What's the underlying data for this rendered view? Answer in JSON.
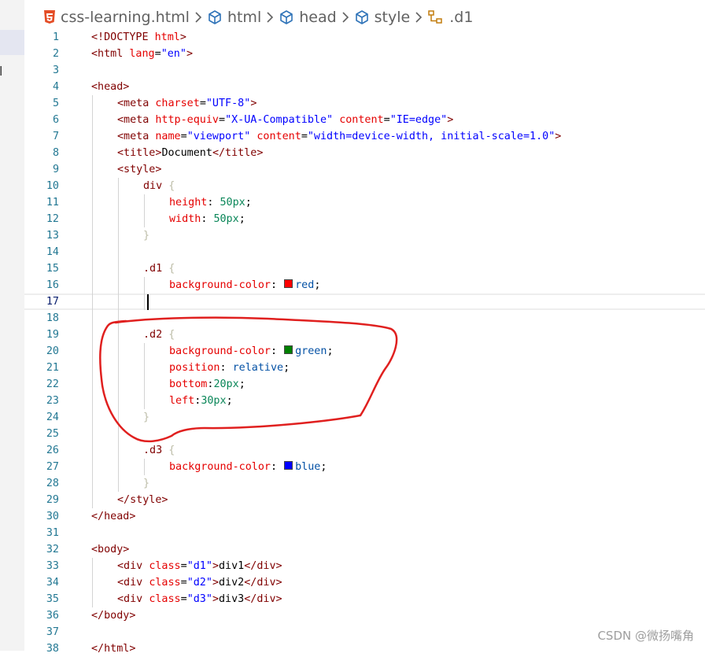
{
  "sidebar": {
    "partial_label": "l"
  },
  "breadcrumb": {
    "items": [
      {
        "label": "css-learning.html",
        "icon": "html5-icon"
      },
      {
        "label": "html",
        "icon": "cube-icon"
      },
      {
        "label": "head",
        "icon": "cube-icon"
      },
      {
        "label": "style",
        "icon": "cube-icon"
      },
      {
        "label": ".d1",
        "icon": "selector-icon"
      }
    ],
    "separator_icon": "chevron-right-icon"
  },
  "editor": {
    "current_line": 17,
    "lines": [
      {
        "n": "1",
        "indent": 0,
        "tokens": [
          [
            "tag",
            "<!DOCTYPE "
          ],
          [
            "attr",
            "html"
          ],
          [
            "tag",
            ">"
          ]
        ]
      },
      {
        "n": "2",
        "indent": 0,
        "tokens": [
          [
            "tag",
            "<html "
          ],
          [
            "attr",
            "lang"
          ],
          [
            "punc",
            "="
          ],
          [
            "str",
            "\"en\""
          ],
          [
            "tag",
            ">"
          ]
        ]
      },
      {
        "n": "3",
        "indent": 0,
        "tokens": []
      },
      {
        "n": "4",
        "indent": 0,
        "tokens": [
          [
            "tag",
            "<head>"
          ]
        ]
      },
      {
        "n": "5",
        "indent": 1,
        "tokens": [
          [
            "tag",
            "<meta "
          ],
          [
            "attr",
            "charset"
          ],
          [
            "punc",
            "="
          ],
          [
            "str",
            "\"UTF-8\""
          ],
          [
            "tag",
            ">"
          ]
        ]
      },
      {
        "n": "6",
        "indent": 1,
        "tokens": [
          [
            "tag",
            "<meta "
          ],
          [
            "attr",
            "http-equiv"
          ],
          [
            "punc",
            "="
          ],
          [
            "str",
            "\"X-UA-Compatible\""
          ],
          [
            "punc",
            " "
          ],
          [
            "attr",
            "content"
          ],
          [
            "punc",
            "="
          ],
          [
            "str",
            "\"IE=edge\""
          ],
          [
            "tag",
            ">"
          ]
        ]
      },
      {
        "n": "7",
        "indent": 1,
        "tokens": [
          [
            "tag",
            "<meta "
          ],
          [
            "attr",
            "name"
          ],
          [
            "punc",
            "="
          ],
          [
            "str",
            "\"viewport\""
          ],
          [
            "punc",
            " "
          ],
          [
            "attr",
            "content"
          ],
          [
            "punc",
            "="
          ],
          [
            "str",
            "\"width=device-width, initial-scale=1.0\""
          ],
          [
            "tag",
            ">"
          ]
        ]
      },
      {
        "n": "8",
        "indent": 1,
        "tokens": [
          [
            "tag",
            "<title>"
          ],
          [
            "text",
            "Document"
          ],
          [
            "tag",
            "</title>"
          ]
        ]
      },
      {
        "n": "9",
        "indent": 1,
        "tokens": [
          [
            "tag",
            "<style>"
          ]
        ]
      },
      {
        "n": "10",
        "indent": 2,
        "tokens": [
          [
            "sel",
            "div "
          ],
          [
            "brace",
            "{"
          ]
        ]
      },
      {
        "n": "11",
        "indent": 3,
        "tokens": [
          [
            "prop",
            "height"
          ],
          [
            "punc",
            ": "
          ],
          [
            "num",
            "50px"
          ],
          [
            "punc",
            ";"
          ]
        ]
      },
      {
        "n": "12",
        "indent": 3,
        "tokens": [
          [
            "prop",
            "width"
          ],
          [
            "punc",
            ": "
          ],
          [
            "num",
            "50px"
          ],
          [
            "punc",
            ";"
          ]
        ]
      },
      {
        "n": "13",
        "indent": 2,
        "tokens": [
          [
            "brace",
            "}"
          ]
        ]
      },
      {
        "n": "14",
        "indent": 0,
        "tokens": []
      },
      {
        "n": "15",
        "indent": 2,
        "tokens": [
          [
            "sel",
            ".d1 "
          ],
          [
            "brace",
            "{"
          ]
        ]
      },
      {
        "n": "16",
        "indent": 3,
        "tokens": [
          [
            "prop",
            "background-color"
          ],
          [
            "punc",
            ": "
          ],
          [
            "swatch",
            "#ff0000"
          ],
          [
            "kw",
            "red"
          ],
          [
            "punc",
            ";"
          ]
        ]
      },
      {
        "n": "17",
        "indent": 0,
        "tokens": []
      },
      {
        "n": "18",
        "indent": 0,
        "tokens": []
      },
      {
        "n": "19",
        "indent": 2,
        "tokens": [
          [
            "sel",
            ".d2 "
          ],
          [
            "brace",
            "{"
          ]
        ]
      },
      {
        "n": "20",
        "indent": 3,
        "tokens": [
          [
            "prop",
            "background-color"
          ],
          [
            "punc",
            ": "
          ],
          [
            "swatch",
            "#008000"
          ],
          [
            "kw",
            "green"
          ],
          [
            "punc",
            ";"
          ]
        ]
      },
      {
        "n": "21",
        "indent": 3,
        "tokens": [
          [
            "prop",
            "position"
          ],
          [
            "punc",
            ": "
          ],
          [
            "kw",
            "relative"
          ],
          [
            "punc",
            ";"
          ]
        ]
      },
      {
        "n": "22",
        "indent": 3,
        "tokens": [
          [
            "prop",
            "bottom"
          ],
          [
            "punc",
            ":"
          ],
          [
            "num",
            "20px"
          ],
          [
            "punc",
            ";"
          ]
        ]
      },
      {
        "n": "23",
        "indent": 3,
        "tokens": [
          [
            "prop",
            "left"
          ],
          [
            "punc",
            ":"
          ],
          [
            "num",
            "30px"
          ],
          [
            "punc",
            ";"
          ]
        ]
      },
      {
        "n": "24",
        "indent": 2,
        "tokens": [
          [
            "brace",
            "}"
          ]
        ]
      },
      {
        "n": "25",
        "indent": 0,
        "tokens": []
      },
      {
        "n": "26",
        "indent": 2,
        "tokens": [
          [
            "sel",
            ".d3 "
          ],
          [
            "brace",
            "{"
          ]
        ]
      },
      {
        "n": "27",
        "indent": 3,
        "tokens": [
          [
            "prop",
            "background-color"
          ],
          [
            "punc",
            ": "
          ],
          [
            "swatch",
            "#0000ff"
          ],
          [
            "kw",
            "blue"
          ],
          [
            "punc",
            ";"
          ]
        ]
      },
      {
        "n": "28",
        "indent": 2,
        "tokens": [
          [
            "brace",
            "}"
          ]
        ]
      },
      {
        "n": "29",
        "indent": 1,
        "tokens": [
          [
            "tag",
            "</style>"
          ]
        ]
      },
      {
        "n": "30",
        "indent": 0,
        "tokens": [
          [
            "tag",
            "</head>"
          ]
        ]
      },
      {
        "n": "31",
        "indent": 0,
        "tokens": []
      },
      {
        "n": "32",
        "indent": 0,
        "tokens": [
          [
            "tag",
            "<body>"
          ]
        ]
      },
      {
        "n": "33",
        "indent": 1,
        "tokens": [
          [
            "tag",
            "<div "
          ],
          [
            "attr",
            "class"
          ],
          [
            "punc",
            "="
          ],
          [
            "str",
            "\"d1\""
          ],
          [
            "tag",
            ">"
          ],
          [
            "text",
            "div1"
          ],
          [
            "tag",
            "</div>"
          ]
        ]
      },
      {
        "n": "34",
        "indent": 1,
        "tokens": [
          [
            "tag",
            "<div "
          ],
          [
            "attr",
            "class"
          ],
          [
            "punc",
            "="
          ],
          [
            "str",
            "\"d2\""
          ],
          [
            "tag",
            ">"
          ],
          [
            "text",
            "div2"
          ],
          [
            "tag",
            "</div>"
          ]
        ]
      },
      {
        "n": "35",
        "indent": 1,
        "tokens": [
          [
            "tag",
            "<div "
          ],
          [
            "attr",
            "class"
          ],
          [
            "punc",
            "="
          ],
          [
            "str",
            "\"d3\""
          ],
          [
            "tag",
            ">"
          ],
          [
            "text",
            "div3"
          ],
          [
            "tag",
            "</div>"
          ]
        ]
      },
      {
        "n": "36",
        "indent": 0,
        "tokens": [
          [
            "tag",
            "</body>"
          ]
        ]
      },
      {
        "n": "37",
        "indent": 0,
        "tokens": []
      },
      {
        "n": "38",
        "indent": 0,
        "tokens": [
          [
            "tag",
            "</html>"
          ]
        ]
      }
    ]
  },
  "annotation": {
    "color": "#e0201f"
  },
  "watermark": "CSDN @微扬嘴角"
}
